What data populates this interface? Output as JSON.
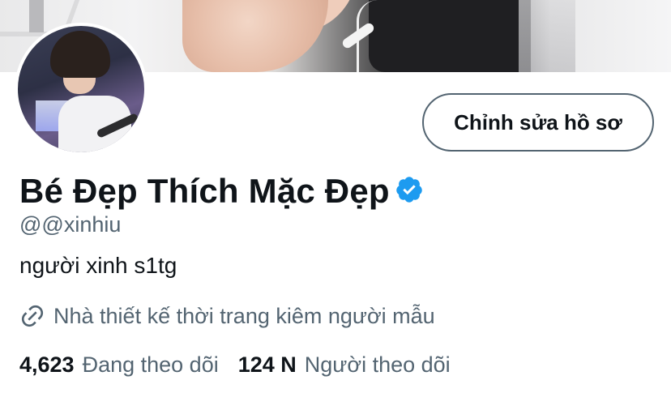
{
  "profile": {
    "edit_button_label": "Chỉnh sửa hồ sơ",
    "display_name": "Bé Đẹp Thích Mặc Đẹp",
    "handle": "@@xinhiu",
    "bio": "người xinh s1tg",
    "profession": "Nhà thiết kế thời trang kiêm người mẫu",
    "verified_badge_icon": "verified-badge-icon",
    "profession_icon": "link-icon"
  },
  "stats": {
    "following_count": "4,623",
    "following_label": "Đang theo dõi",
    "followers_count": "124 N",
    "followers_label": "Người theo dõi"
  },
  "colors": {
    "verified_blue": "#1d9bf0",
    "primary_text": "#0f1419",
    "secondary_text": "#536471",
    "button_border": "#536471"
  }
}
